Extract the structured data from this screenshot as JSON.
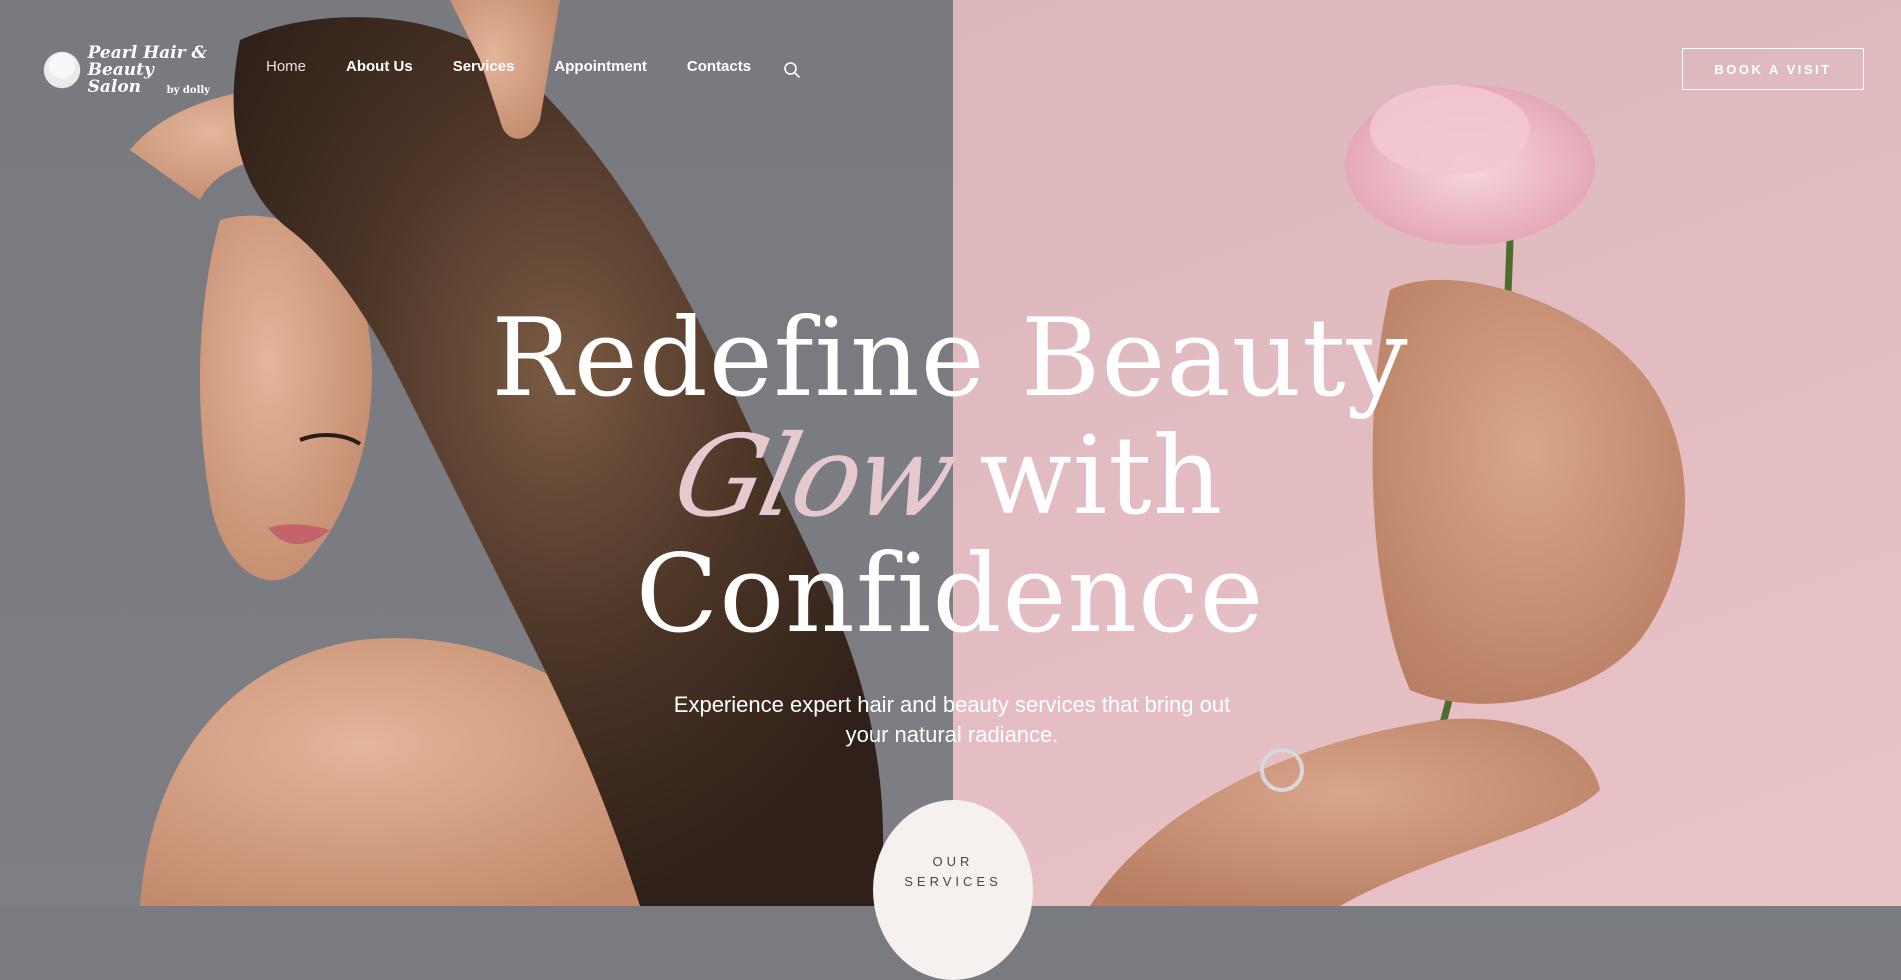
{
  "brand": {
    "name_line1": "Pearl Hair &",
    "name_line2": "Beauty Salon",
    "byline": "by dolly",
    "logo_icon": "woman-silhouette-icon"
  },
  "nav": {
    "items": [
      {
        "label": "Home",
        "active": true
      },
      {
        "label": "About Us"
      },
      {
        "label": "Services"
      },
      {
        "label": "Appointment"
      },
      {
        "label": "Contacts"
      }
    ],
    "search_icon": "search-icon"
  },
  "cta": {
    "book_label": "BOOK A VISIT"
  },
  "hero": {
    "line1": "Redefine Beauty",
    "script_word": "Glow",
    "line2_rest": "with",
    "line3": "Confidence",
    "subtitle_line1": "Experience expert hair and beauty services that bring out",
    "subtitle_line2": "your natural radiance.",
    "services_line1": "OUR",
    "services_line2": "SERVICES"
  },
  "colors": {
    "left_bg": "#7a7b81",
    "right_bg": "#e2bcc0",
    "accent_script": "#e6c9cf",
    "button_bg": "#f6f1ee"
  }
}
